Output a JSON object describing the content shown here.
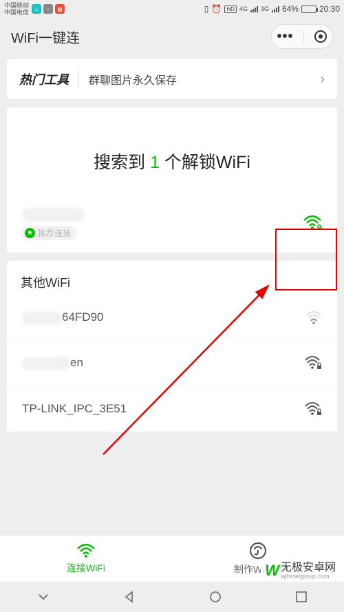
{
  "status": {
    "carrier_line1": "中国移动",
    "carrier_line2": "中国电信",
    "net_label_1": "4G",
    "net_label_2": "3G",
    "battery_pct": "64%",
    "time": "20:30"
  },
  "header": {
    "app_title": "WiFi一键连"
  },
  "promo": {
    "title": "热门工具",
    "subtitle": "群聊图片永久保存"
  },
  "search": {
    "prefix": "搜索到 ",
    "count": "1",
    "suffix": " 个解锁WiFi",
    "recommend_label": "推荐连接"
  },
  "other": {
    "title": "其他WiFi",
    "items": [
      {
        "suffix": "64FD90",
        "locked": false,
        "strength": "weak"
      },
      {
        "suffix": "en",
        "locked": true,
        "strength": "full"
      },
      {
        "name": "TP-LINK_IPC_3E51",
        "locked": true,
        "strength": "full"
      }
    ]
  },
  "tabs": {
    "connect": "连接WiFi",
    "make": "制作WiFi码"
  },
  "watermark": {
    "logo": "W",
    "text": "无极安卓网",
    "url": "wjhotelgroup.com"
  }
}
